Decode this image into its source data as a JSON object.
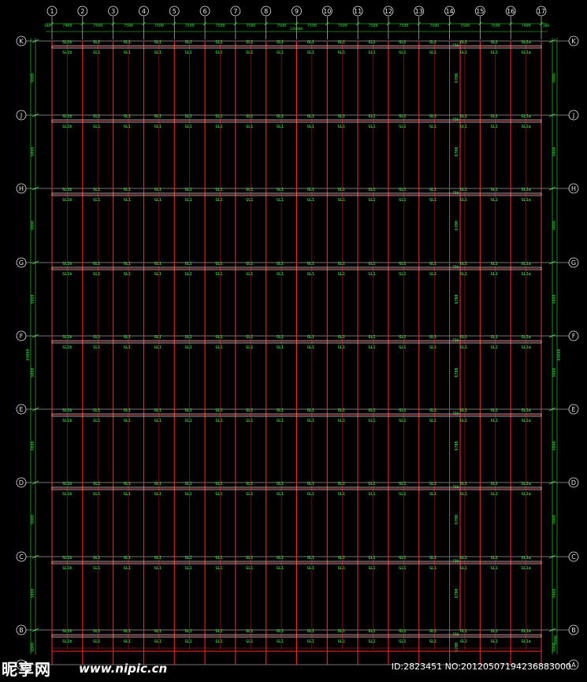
{
  "drawing": {
    "column_axes": [
      "1",
      "2",
      "3",
      "4",
      "5",
      "6",
      "7",
      "8",
      "9",
      "10",
      "11",
      "12",
      "13",
      "14",
      "15",
      "16",
      "17"
    ],
    "row_axes": [
      "K",
      "J",
      "H",
      "G",
      "F",
      "E",
      "D",
      "C",
      "B",
      "A"
    ],
    "span_dims": [
      "7400",
      "7500",
      "7500",
      "7500",
      "7500",
      "7500",
      "7500",
      "7500",
      "7500",
      "7500",
      "7500",
      "7500",
      "7500",
      "7500",
      "7500",
      "7400"
    ],
    "edge_dim": "100",
    "total_length": "120000",
    "bay_dim_left": [
      "9000",
      "9000",
      "9000",
      "9000",
      "9000",
      "9000",
      "9000",
      "9000",
      "9000"
    ],
    "bay_dim_right": [
      "9000",
      "9000",
      "9000",
      "9000",
      "9000",
      "9000",
      "9000",
      "9000",
      "9000"
    ],
    "small_dim_bottom": "2000",
    "total_width": "84000",
    "column_label": "750",
    "beam_label": "GL1",
    "beam_label_end": "GL1a",
    "beam_label_start": "GL1b",
    "mid_dim": "6700"
  },
  "watermark": {
    "logo": "昵享网",
    "url": "www.nipic.cn",
    "id_text": "ID:2823451 NO:20120507194236883000"
  },
  "colors": {
    "axis": "#e8e8e8",
    "dimension": "#33dd33",
    "member": "#ff2a2a",
    "label": "#44ff44",
    "beam_fill": "#ffffff"
  }
}
